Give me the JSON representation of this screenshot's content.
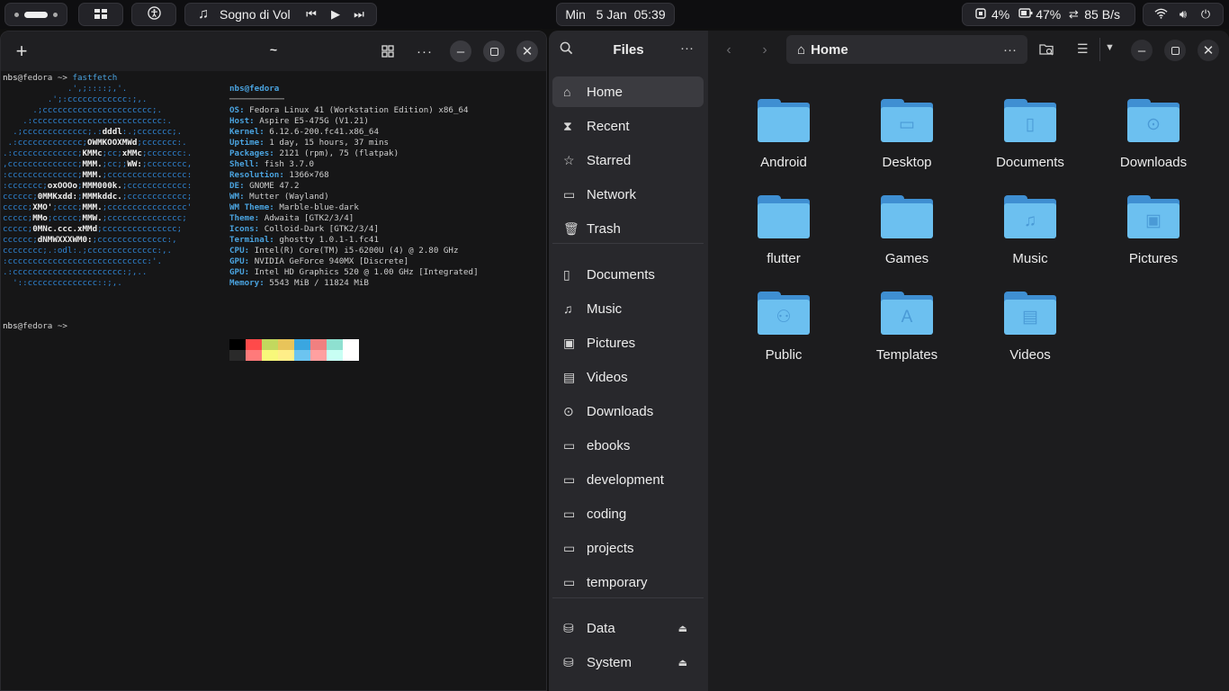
{
  "topbar": {
    "media_title": "Sogno di Vol",
    "datetime": "Min   5 Jan  05:39",
    "cpu": "4%",
    "battery": "47%",
    "network": "85 B/s",
    "icons": [
      "workspaces-indicator",
      "apps-grid-icon",
      "accessibility-icon",
      "music-note-icon",
      "prev-track-icon",
      "play-icon",
      "next-track-icon",
      "cpu-icon",
      "battery-icon",
      "network-transfer-icon",
      "wifi-icon",
      "volume-icon",
      "power-icon"
    ]
  },
  "terminal": {
    "title": "~",
    "prompt_user": "nbs",
    "prompt_host": "@fedora",
    "prompt_suffix": " ~> ",
    "command": "fastfetch",
    "logo_lines": [
      "             .',;::::;,'.",
      "         .';:cccccccccccc:;,.",
      "      .;cccccccccccccccccccccc;.",
      "    .:cccccccccccccccccccccccccc:.",
      "  .;ccccccccccccc;.:dddl:.;ccccccc;.",
      " .:ccccccccccccc;OWMKOOXMWd;ccccccc:.",
      ".:ccccccccccccc;KMMc;cc;xMMc;ccccccc:.",
      ",cccccccccccccc;MMM.;cc;;WW:;cccccccc,",
      ":cccccccccccccc;MMM.;cccccccccccccccc:",
      ":ccccccc;oxOOOo;MMM000k.;cccccccccccc:",
      "cccccc;0MMKxdd:;MMMkddc.;cccccccccccc;",
      "ccccc;XMO';cccc;MMM.;cccccccccccccccc'",
      "ccccc;MMo;ccccc;MMW.;ccccccccccccccc;",
      "ccccc;0MNc.ccc.xMMd;ccccccccccccccc;",
      "cccccc;dNMWXXXWM0:;cccccccccccccc:,",
      "cccccccc;.:odl:.;cccccccccccccc:,.",
      ":cccccccccccccccccccccccccccc:'.",
      ".:cccccccccccccccccccccc:;,..",
      "  '::cccccccccccccc::;,."
    ],
    "logo_bold": [
      [],
      [],
      [],
      [],
      [
        "dddl"
      ],
      [
        "OWMKOOXMWd"
      ],
      [
        "KMMc",
        "xMMc"
      ],
      [
        "MMM.",
        "WW:"
      ],
      [
        "MMM."
      ],
      [
        "oxOOOo",
        "MMM000k."
      ],
      [
        "0MMKxdd:",
        "MMMkddc."
      ],
      [
        "XMO'",
        "MMM."
      ],
      [
        "MMo",
        "MMW."
      ],
      [
        "0MNc.ccc.xMMd"
      ],
      [
        "dNMWXXXWM0:"
      ],
      [],
      [],
      [],
      []
    ],
    "info_header_user": "nbs",
    "info_header_host": "@fedora",
    "info_rule": "───────────",
    "info": [
      {
        "k": "OS",
        "v": "Fedora Linux 41 (Workstation Edition) x86_64"
      },
      {
        "k": "Host",
        "v": "Aspire E5-475G (V1.21)"
      },
      {
        "k": "Kernel",
        "v": "6.12.6-200.fc41.x86_64"
      },
      {
        "k": "Uptime",
        "v": "1 day, 15 hours, 37 mins"
      },
      {
        "k": "Packages",
        "v": "2121 (rpm), 75 (flatpak)"
      },
      {
        "k": "Shell",
        "v": "fish 3.7.0"
      },
      {
        "k": "Resolution",
        "v": "1366×768"
      },
      {
        "k": "DE",
        "v": "GNOME 47.2"
      },
      {
        "k": "WM",
        "v": "Mutter (Wayland)"
      },
      {
        "k": "WM Theme",
        "v": "Marble-blue-dark"
      },
      {
        "k": "Theme",
        "v": "Adwaita [GTK2/3/4]"
      },
      {
        "k": "Icons",
        "v": "Colloid-Dark [GTK2/3/4]"
      },
      {
        "k": "Terminal",
        "v": "ghostty 1.0.1-1.fc41"
      },
      {
        "k": "CPU",
        "v": "Intel(R) Core(TM) i5-6200U (4) @ 2.80 GHz"
      },
      {
        "k": "GPU",
        "v": "NVIDIA GeForce 940MX [Discrete]"
      },
      {
        "k": "GPU",
        "v": "Intel HD Graphics 520 @ 1.00 GHz [Integrated]"
      },
      {
        "k": "Memory",
        "v": "5543 MiB / 11824 MiB"
      }
    ],
    "swatch_colors_top": [
      "#000000",
      "#ff4a4a",
      "#c2d85e",
      "#e8c45a",
      "#3aa6e0",
      "#f08080",
      "#8ee0d0",
      "#ffffff"
    ],
    "swatch_colors_bottom": [
      "#2a2a2a",
      "#ff7a7a",
      "#f8f87a",
      "#ffee88",
      "#6cc4f0",
      "#ffa0a0",
      "#c8fff4",
      "#ffffff"
    ]
  },
  "files": {
    "sidebar_title": "Files",
    "places": [
      {
        "label": "Home",
        "icon": "home-icon",
        "glyph": "⌂",
        "selected": true
      },
      {
        "label": "Recent",
        "icon": "recent-icon",
        "glyph": "⧗"
      },
      {
        "label": "Starred",
        "icon": "star-icon",
        "glyph": "☆"
      },
      {
        "label": "Network",
        "icon": "network-icon",
        "glyph": "▭"
      },
      {
        "label": "Trash",
        "icon": "trash-icon",
        "glyph": "🗑"
      }
    ],
    "bookmarks": [
      {
        "label": "Documents",
        "icon": "document-icon",
        "glyph": "▯"
      },
      {
        "label": "Music",
        "icon": "music-icon",
        "glyph": "♫"
      },
      {
        "label": "Pictures",
        "icon": "pictures-icon",
        "glyph": "▣"
      },
      {
        "label": "Videos",
        "icon": "videos-icon",
        "glyph": "▤"
      },
      {
        "label": "Downloads",
        "icon": "downloads-icon",
        "glyph": "⊙"
      },
      {
        "label": "ebooks",
        "icon": "folder-icon",
        "glyph": "▭"
      },
      {
        "label": "development",
        "icon": "folder-icon",
        "glyph": "▭"
      },
      {
        "label": "coding",
        "icon": "folder-icon",
        "glyph": "▭"
      },
      {
        "label": "projects",
        "icon": "folder-icon",
        "glyph": "▭"
      },
      {
        "label": "temporary",
        "icon": "folder-icon",
        "glyph": "▭"
      }
    ],
    "devices": [
      {
        "label": "Data",
        "icon": "drive-icon",
        "glyph": "⛁"
      },
      {
        "label": "System",
        "icon": "drive-icon",
        "glyph": "⛁"
      }
    ],
    "path": "Home",
    "folders": [
      {
        "name": "Android",
        "emblem": ""
      },
      {
        "name": "Desktop",
        "emblem": "▭"
      },
      {
        "name": "Documents",
        "emblem": "▯"
      },
      {
        "name": "Downloads",
        "emblem": "⊙"
      },
      {
        "name": "flutter",
        "emblem": ""
      },
      {
        "name": "Games",
        "emblem": ""
      },
      {
        "name": "Music",
        "emblem": "♫"
      },
      {
        "name": "Pictures",
        "emblem": "▣"
      },
      {
        "name": "Public",
        "emblem": "⚇"
      },
      {
        "name": "Templates",
        "emblem": "A"
      },
      {
        "name": "Videos",
        "emblem": "▤"
      }
    ],
    "accent": "#6cc0f0"
  }
}
